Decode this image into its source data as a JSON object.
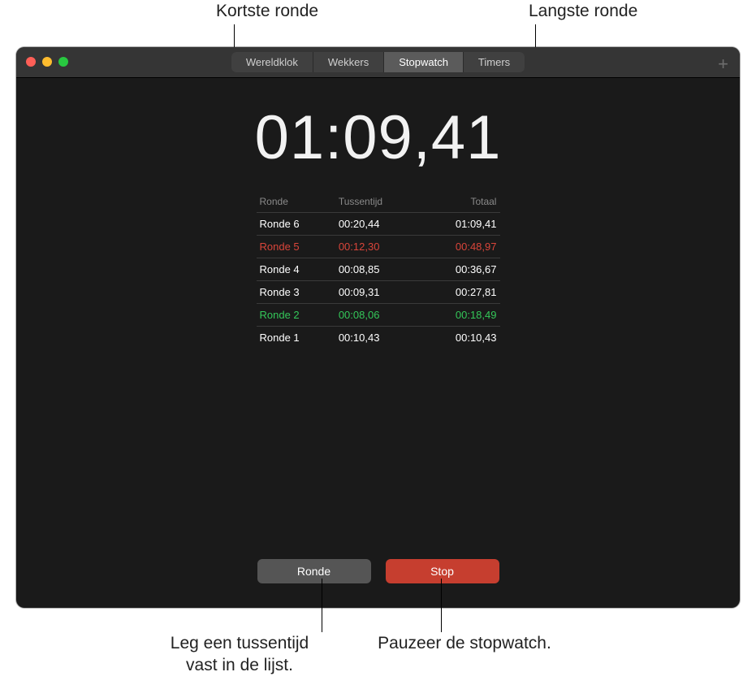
{
  "callouts": {
    "top_left": "Kortste ronde",
    "top_right": "Langste ronde",
    "bottom_left_l1": "Leg een tussentijd",
    "bottom_left_l2": "vast in de lijst.",
    "bottom_right": "Pauzeer de stopwatch."
  },
  "tabs": {
    "t0": "Wereldklok",
    "t1": "Wekkers",
    "t2": "Stopwatch",
    "t3": "Timers"
  },
  "time": "01:09,41",
  "table": {
    "h1": "Ronde",
    "h2": "Tussentijd",
    "h3": "Totaal",
    "rows": [
      {
        "name": "Ronde 6",
        "split": "00:20,44",
        "total": "01:09,41",
        "cls": ""
      },
      {
        "name": "Ronde 5",
        "split": "00:12,30",
        "total": "00:48,97",
        "cls": "longest"
      },
      {
        "name": "Ronde 4",
        "split": "00:08,85",
        "total": "00:36,67",
        "cls": ""
      },
      {
        "name": "Ronde 3",
        "split": "00:09,31",
        "total": "00:27,81",
        "cls": ""
      },
      {
        "name": "Ronde 2",
        "split": "00:08,06",
        "total": "00:18,49",
        "cls": "shortest"
      },
      {
        "name": "Ronde 1",
        "split": "00:10,43",
        "total": "00:10,43",
        "cls": ""
      }
    ]
  },
  "buttons": {
    "lap": "Ronde",
    "stop": "Stop"
  },
  "colors": {
    "shortest": "#34c759",
    "longest": "#d9453a",
    "stop_bg": "#c63e2f"
  }
}
